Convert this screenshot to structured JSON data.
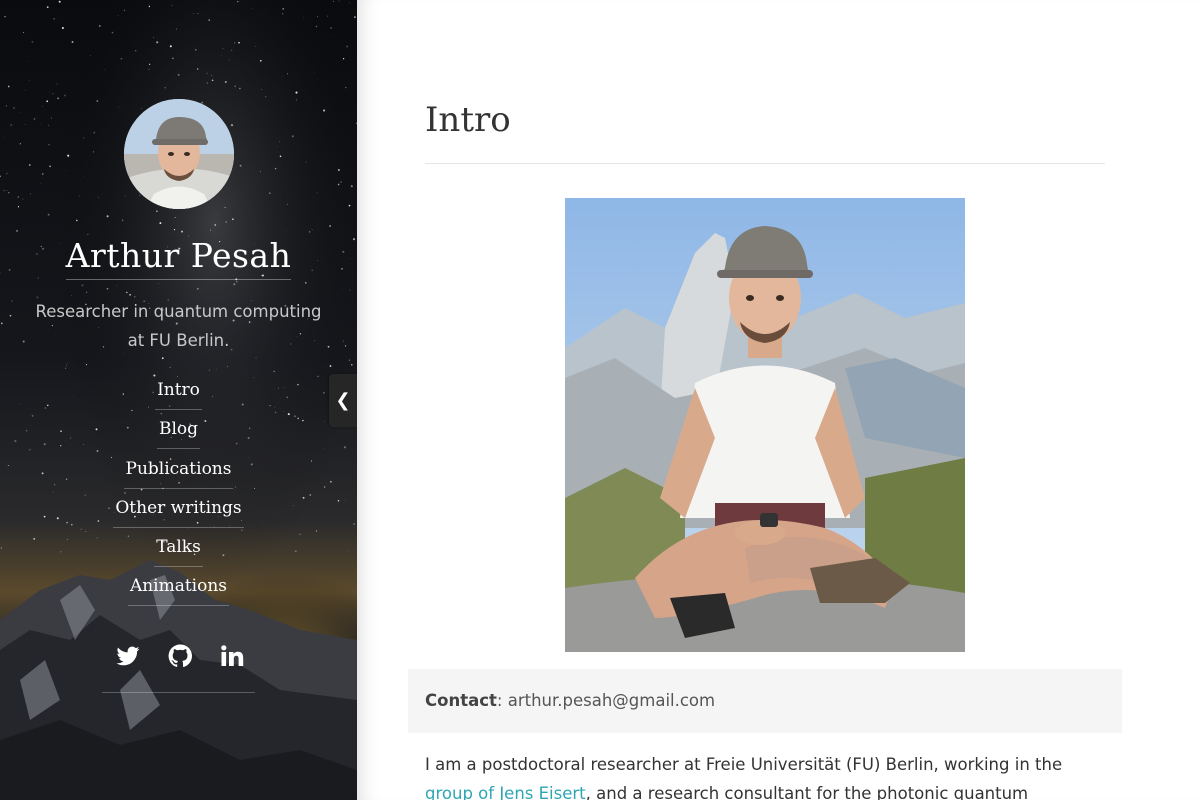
{
  "sidebar": {
    "name": "Arthur Pesah",
    "tagline": "Researcher in quantum computing at FU Berlin.",
    "nav": [
      {
        "label": "Intro"
      },
      {
        "label": "Blog"
      },
      {
        "label": "Publications"
      },
      {
        "label": "Other writings"
      },
      {
        "label": "Talks"
      },
      {
        "label": "Animations"
      }
    ],
    "social": [
      {
        "icon": "twitter-icon"
      },
      {
        "icon": "github-icon"
      },
      {
        "icon": "linkedin-icon"
      }
    ],
    "toggle_glyph": "❮"
  },
  "main": {
    "title": "Intro",
    "contact": {
      "label": "Contact",
      "separator": ": ",
      "email": "arthur.pesah@gmail.com"
    },
    "bio": {
      "text_1": "I am a postdoctoral researcher at Freie Universität (FU) Berlin, working in the ",
      "link": "group of Jens Eisert",
      "text_2": ", and a research consultant for the photonic quantum computing"
    }
  },
  "colors": {
    "link": "#2fa6b2",
    "heading": "#333333",
    "contact_bg": "#f5f5f5",
    "sidebar_text": "#ffffff"
  }
}
